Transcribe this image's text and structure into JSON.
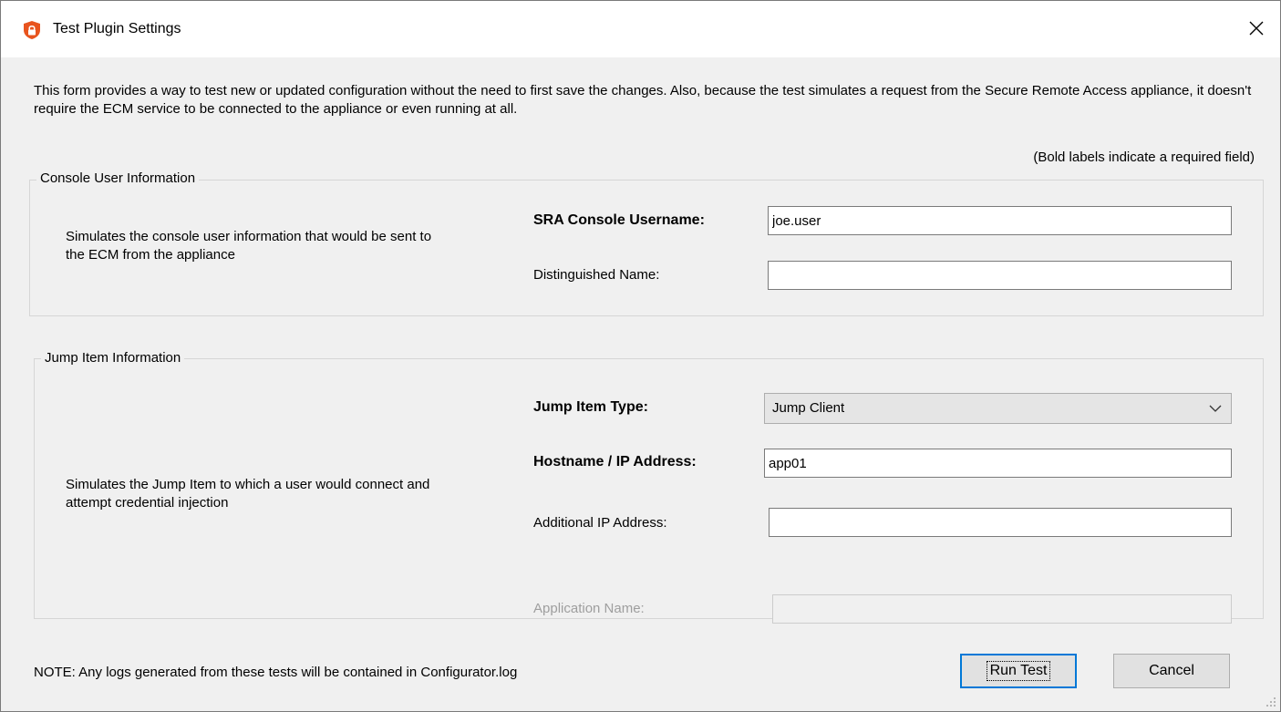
{
  "window": {
    "title": "Test Plugin Settings"
  },
  "intro": {
    "text": "This form provides a way to test new or updated configuration without the need to first save the changes.  Also, because the test simulates a request from the Secure Remote Access appliance, it doesn't require the ECM service to be connected to the appliance or even running at all."
  },
  "required_note": "(Bold labels indicate a required field)",
  "console_group": {
    "title": "Console User Information",
    "description": "Simulates the console user information that would be sent to the ECM from the appliance",
    "username_label": "SRA Console Username:",
    "username_value": "joe.user",
    "dn_label": "Distinguished Name:",
    "dn_value": ""
  },
  "jump_group": {
    "title": "Jump Item Information",
    "description": "Simulates the Jump Item to which a user would connect and attempt credential injection",
    "type_label": "Jump Item Type:",
    "type_value": "Jump Client",
    "host_label": "Hostname / IP Address:",
    "host_value": "app01",
    "addl_ip_label": "Additional IP Address:",
    "addl_ip_value": "",
    "app_name_label": "Application Name:",
    "app_name_value": ""
  },
  "footer": {
    "note": "NOTE: Any logs generated from these tests will be contained in Configurator.log",
    "run_label": "Run Test",
    "cancel_label": "Cancel"
  },
  "colors": {
    "accent": "#0078d7",
    "app_icon": "#e8541e",
    "window_bg": "#f0f0f0"
  },
  "icons": {
    "app": "shield-icon",
    "close": "close-icon",
    "dropdown": "chevron-down-icon",
    "resize": "resize-grip-icon"
  }
}
